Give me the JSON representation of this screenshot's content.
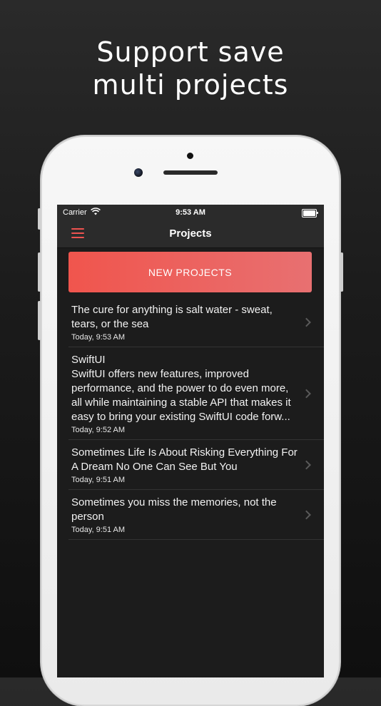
{
  "headline": {
    "line1": "Support save",
    "line2": "multi projects"
  },
  "statusbar": {
    "carrier": "Carrier",
    "time": "9:53 AM",
    "icons": [
      "wifi-icon",
      "battery-icon"
    ]
  },
  "navbar": {
    "title": "Projects",
    "menu_icon": "hamburger-menu-icon"
  },
  "new_button": {
    "label": "NEW PROJECTS"
  },
  "projects": [
    {
      "title": "The cure for anything is salt water - sweat, tears, or the sea",
      "body": "",
      "date": "Today, 9:53 AM"
    },
    {
      "title": "SwiftUI",
      "body": "SwiftUI offers new features, improved performance, and the power to do even more, all while maintaining a stable API that makes it easy to bring your existing SwiftUI code forw...",
      "date": "Today, 9:52 AM"
    },
    {
      "title": "Sometimes Life Is About Risking Everything For A Dream No One Can See But You",
      "body": "",
      "date": "Today, 9:51 AM"
    },
    {
      "title": "Sometimes you miss the memories, not the person",
      "body": "",
      "date": "Today, 9:51 AM"
    }
  ],
  "colors": {
    "accent": "#ef5350",
    "background": "#1c1c1c",
    "bar": "#2b2b2b"
  }
}
